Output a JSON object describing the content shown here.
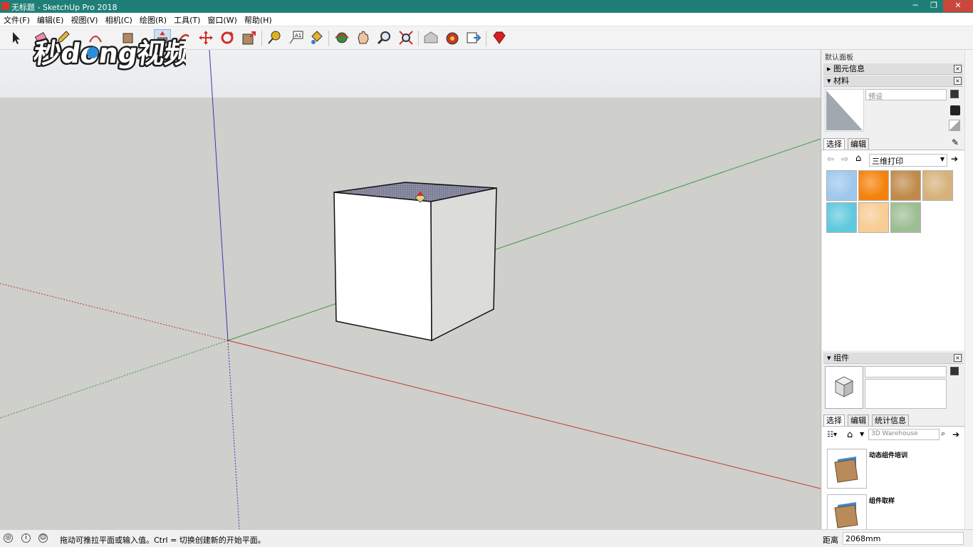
{
  "window": {
    "title": "无标题 - SketchUp Pro 2018",
    "min": "─",
    "max": "❐",
    "close": "✕"
  },
  "menu": [
    "文件(F)",
    "编辑(E)",
    "视图(V)",
    "相机(C)",
    "绘图(R)",
    "工具(T)",
    "窗口(W)",
    "帮助(H)"
  ],
  "toolbar": {
    "tools": [
      "select-icon",
      "eraser-icon",
      "pencil-icon",
      "arc-icon",
      "rectangle-icon",
      "push-pull-icon",
      "offset-icon",
      "move-icon",
      "rotate-icon",
      "scale-icon",
      "tape-measure-icon",
      "text-icon",
      "paint-bucket-icon",
      "orbit-icon",
      "pan-icon",
      "zoom-icon",
      "zoom-extents-icon",
      "warehouse-icon",
      "extension-icon",
      "share-icon",
      "ruby-icon"
    ]
  },
  "logo": {
    "text": "秒懂视频"
  },
  "viewport": {
    "colors": {
      "background": "#cfcfcc",
      "sky": "#eceef1",
      "red_axis": "#c0392b",
      "green_axis": "#3f9a3f",
      "blue_axis": "#3a3ab0"
    }
  },
  "panel": {
    "tray_title": "默认面板",
    "entity_info": {
      "label": "图元信息",
      "close": "×"
    },
    "materials": {
      "label": "材料",
      "close": "×",
      "name_placeholder": "预设",
      "tab_select": "选择",
      "tab_edit": "编辑",
      "library": "三维打印",
      "swatches": [
        "#9ec8ee",
        "#f5820a",
        "#c08a4a",
        "#d6b27a",
        "#5fc9dd",
        "#f8cc94",
        "#9dbe93"
      ]
    },
    "components": {
      "label": "组件",
      "close": "×",
      "tab_select": "选择",
      "tab_edit": "编辑",
      "tab_stats": "统计信息",
      "search_placeholder": "3D Warehouse",
      "items": [
        "动态组件培训",
        "组件取样"
      ]
    }
  },
  "status": {
    "hint": "拖动可推拉平面或输入值。Ctrl = 切换创建新的开始平面。",
    "measure_label": "距离",
    "measure_value": "2068mm"
  }
}
